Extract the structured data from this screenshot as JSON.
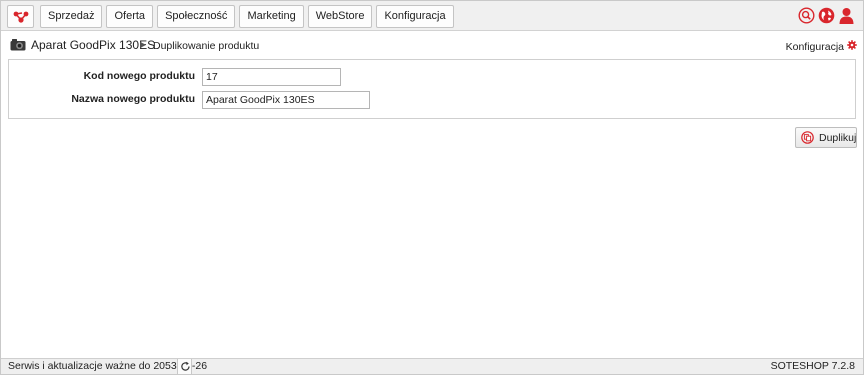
{
  "nav": {
    "logo_icon": "soteshop-logo-icon",
    "items": [
      {
        "label": "Sprzedaż"
      },
      {
        "label": "Oferta"
      },
      {
        "label": "Społeczność"
      },
      {
        "label": "Marketing"
      },
      {
        "label": "WebStore"
      },
      {
        "label": "Konfiguracja"
      }
    ],
    "right_icons": [
      "search-icon",
      "globe-icon",
      "user-icon"
    ]
  },
  "breadcrumb": {
    "product_icon": "camera-icon",
    "product_title": "Aparat GoodPix 130ES",
    "separator": "▶",
    "current": "Duplikowanie produktu",
    "config_label": "Konfiguracja",
    "config_icon": "gear-icon"
  },
  "form": {
    "code_label": "Kod nowego produktu",
    "code_value": "17",
    "name_label": "Nazwa nowego produktu",
    "name_value": "Aparat GoodPix 130ES"
  },
  "actions": {
    "duplicate_label": "Duplikuj",
    "duplicate_icon": "duplicate-icon"
  },
  "status": {
    "service_text": "Serwis i aktualizacje ważne do 2053-08-26",
    "refresh_icon": "refresh-icon",
    "version": "SOTESHOP 7.2.8"
  },
  "colors": {
    "accent": "#d9262c",
    "toolbar_bg": "#f0f0f0"
  }
}
